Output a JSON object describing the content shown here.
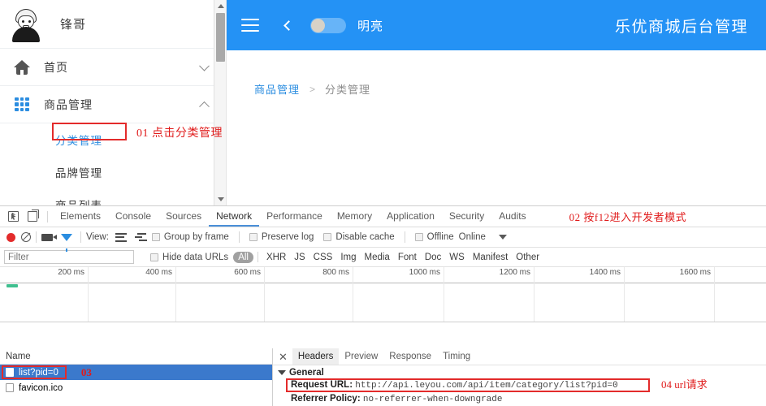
{
  "app": {
    "brand_title": "乐优商城后台管理",
    "header": {
      "menu_icon": "hamburger-icon",
      "back_icon": "chevron-left-icon",
      "theme_toggle_label": "明亮",
      "theme_toggle_state": "on"
    },
    "breadcrumb": {
      "parent": "商品管理",
      "separator": ">",
      "current": "分类管理"
    }
  },
  "sidebar": {
    "user": {
      "name": "锋哥",
      "avatar": "user-avatar-illustration"
    },
    "items": [
      {
        "label": "首页",
        "icon": "home-icon",
        "chevron": "down"
      },
      {
        "label": "商品管理",
        "icon": "grid-icon",
        "chevron": "up"
      }
    ],
    "sub_items": [
      {
        "label": "分类管理",
        "active": true
      },
      {
        "label": "品牌管理",
        "active": false
      },
      {
        "label": "商品列表",
        "active": false
      }
    ]
  },
  "annotations": [
    {
      "id": "01",
      "text": "01  点击分类管理"
    },
    {
      "id": "02",
      "text": "02  按f12进入开发者模式"
    },
    {
      "id": "03",
      "text": "03"
    },
    {
      "id": "04",
      "text": "04  url请求"
    }
  ],
  "devtools": {
    "panel_tabs": [
      {
        "label": "Elements",
        "active": false
      },
      {
        "label": "Console",
        "active": false
      },
      {
        "label": "Sources",
        "active": false
      },
      {
        "label": "Network",
        "active": true
      },
      {
        "label": "Performance",
        "active": false
      },
      {
        "label": "Memory",
        "active": false
      },
      {
        "label": "Application",
        "active": false
      },
      {
        "label": "Security",
        "active": false
      },
      {
        "label": "Audits",
        "active": false
      }
    ],
    "toolbar": {
      "record_icon": "record-icon",
      "clear_icon": "clear-icon",
      "screenshot_icon": "camera-icon",
      "filter_icon": "funnel-icon",
      "view_label": "View:",
      "list_view_icon": "list-view-icon",
      "waterfall_view_icon": "waterfall-view-icon",
      "group_by_frame": "Group by frame",
      "preserve_log": "Preserve log",
      "disable_cache": "Disable cache",
      "offline": "Offline",
      "throttling": "Online",
      "throttling_caret": "chevron-down-icon"
    },
    "filterbar": {
      "filter_placeholder": "Filter",
      "filter_value": "",
      "hide_data_urls": "Hide data URLs",
      "types": [
        {
          "label": "All",
          "selected": true
        },
        {
          "label": "XHR",
          "selected": false
        },
        {
          "label": "JS",
          "selected": false
        },
        {
          "label": "CSS",
          "selected": false
        },
        {
          "label": "Img",
          "selected": false
        },
        {
          "label": "Media",
          "selected": false
        },
        {
          "label": "Font",
          "selected": false
        },
        {
          "label": "Doc",
          "selected": false
        },
        {
          "label": "WS",
          "selected": false
        },
        {
          "label": "Manifest",
          "selected": false
        },
        {
          "label": "Other",
          "selected": false
        }
      ]
    },
    "timeline": {
      "ticks": [
        "200 ms",
        "400 ms",
        "600 ms",
        "800 ms",
        "1000 ms",
        "1200 ms",
        "1400 ms",
        "1600 ms"
      ]
    },
    "request_list": {
      "column_header": "Name",
      "rows": [
        {
          "name": "list?pid=0",
          "selected": true
        },
        {
          "name": "favicon.ico",
          "selected": false
        }
      ]
    },
    "detail": {
      "close_icon": "close-icon",
      "tabs": [
        {
          "label": "Headers",
          "active": true
        },
        {
          "label": "Preview",
          "active": false
        },
        {
          "label": "Response",
          "active": false
        },
        {
          "label": "Timing",
          "active": false
        }
      ],
      "section_title": "General",
      "fields": [
        {
          "key": "Request URL:",
          "value": "http://api.leyou.com/api/item/category/list?pid=0"
        },
        {
          "key": "Referrer Policy:",
          "value": "no-referrer-when-downgrade"
        }
      ]
    }
  },
  "colors": {
    "brand_blue": "#2492f5",
    "accent_link": "#2b8de0",
    "annotation_red": "#e01b1b",
    "row_selected": "#3b79cc"
  }
}
